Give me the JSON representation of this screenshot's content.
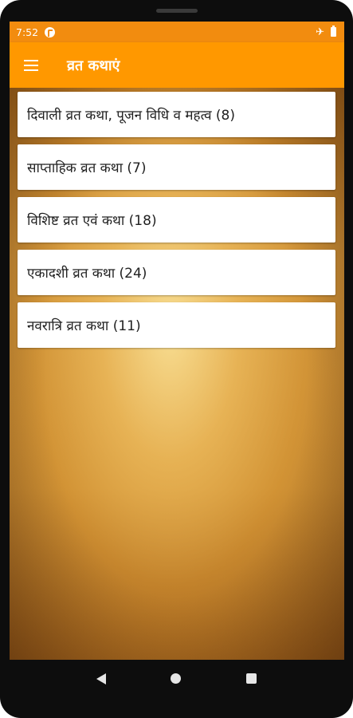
{
  "status_bar": {
    "time": "7:52",
    "vpn_icon": "vpn-key-icon",
    "airplane_icon": "airplane-icon",
    "battery_icon": "battery-icon"
  },
  "app_bar": {
    "title": "व्रत कथाएं",
    "menu_icon": "hamburger-menu-icon",
    "color": "#ff9800"
  },
  "list": {
    "items": [
      {
        "label": "दिवाली व्रत कथा, पूजन विधि व महत्व (8)"
      },
      {
        "label": "साप्ताहिक व्रत कथा (7)"
      },
      {
        "label": "विशिष्ट व्रत एवं कथा (18)"
      },
      {
        "label": "एकादशी व्रत कथा (24)"
      },
      {
        "label": "नवरात्रि व्रत कथा (11)"
      }
    ]
  },
  "nav_bar": {
    "back_icon": "back-triangle-icon",
    "home_icon": "home-circle-icon",
    "recents_icon": "recents-square-icon"
  },
  "colors": {
    "status_bar": "#f28c0f",
    "app_bar": "#ff9800",
    "background": "#c88a2a"
  }
}
